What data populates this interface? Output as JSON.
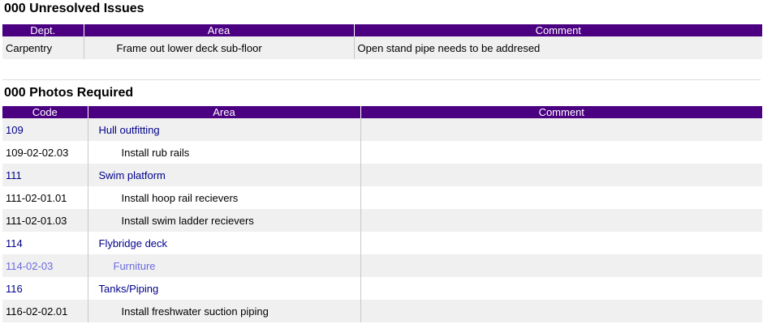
{
  "unresolved": {
    "title": "000 Unresolved Issues",
    "headers": [
      "Dept.",
      "Area",
      "Comment"
    ],
    "rows": [
      {
        "dept": "Carpentry",
        "area": "Frame out lower deck sub-floor",
        "comment": "Open stand pipe needs to be addresed"
      }
    ]
  },
  "photos": {
    "title": "000 Photos Required",
    "headers": [
      "Code",
      "Area",
      "Comment"
    ],
    "rows": [
      {
        "code": "109",
        "area": "Hull outfitting",
        "comment": "",
        "kind": "group"
      },
      {
        "code": "109-02-02.03",
        "area": "Install rub rails",
        "comment": "",
        "kind": "item"
      },
      {
        "code": "111",
        "area": "Swim platform",
        "comment": "",
        "kind": "group"
      },
      {
        "code": "111-02-01.01",
        "area": "Install hoop rail recievers",
        "comment": "",
        "kind": "item"
      },
      {
        "code": "111-02-01.03",
        "area": "Install swim ladder recievers",
        "comment": "",
        "kind": "item"
      },
      {
        "code": "114",
        "area": "Flybridge deck",
        "comment": "",
        "kind": "group"
      },
      {
        "code": "114-02-03",
        "area": "Furniture",
        "comment": "",
        "kind": "subgroup"
      },
      {
        "code": "116",
        "area": "Tanks/Piping",
        "comment": "",
        "kind": "group"
      },
      {
        "code": "116-02-02.01",
        "area": "Install freshwater  suction piping",
        "comment": "",
        "kind": "item"
      }
    ]
  },
  "colors": {
    "header_bg": "#4b0082",
    "group_text": "#00008b",
    "subgroup_text": "#6b6bdc",
    "row_alt": "#f0f0f0"
  }
}
